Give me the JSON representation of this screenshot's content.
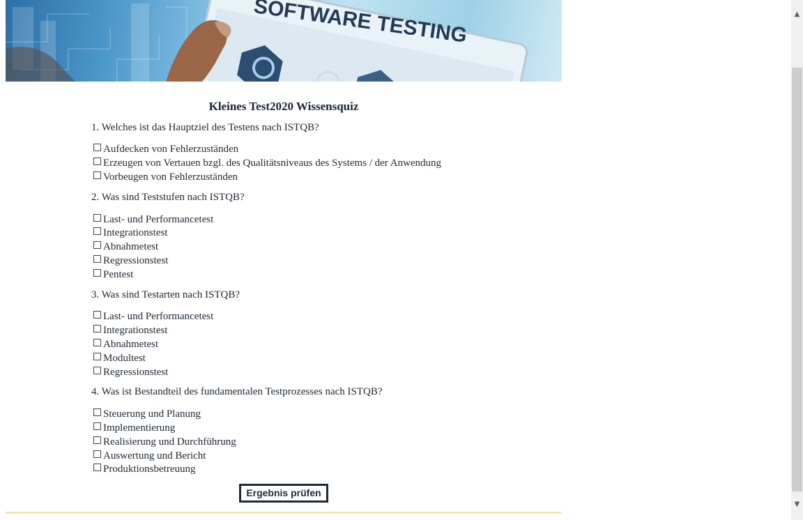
{
  "banner": {
    "text": "SOFTWARE TESTING"
  },
  "quiz": {
    "title": "Kleines Test2020 Wissensquiz",
    "questions": [
      {
        "text": "1. Welches ist das Hauptziel des Testens nach ISTQB?",
        "options": [
          "Aufdecken von Fehlerzuständen",
          "Erzeugen von Vertauen bzgl. des Qualitätsniveaus des Systems / der Anwendung",
          "Vorbeugen von Fehlerzuständen"
        ]
      },
      {
        "text": "2. Was sind Teststufen nach ISTQB?",
        "options": [
          "Last- und Performancetest",
          "Integrationstest",
          "Abnahmetest",
          "Regressionstest",
          "Pentest"
        ]
      },
      {
        "text": "3. Was sind Testarten nach ISTQB?",
        "options": [
          "Last- und Performancetest",
          "Integrationstest",
          "Abnahmetest",
          "Modultest",
          "Regressionstest"
        ]
      },
      {
        "text": "4. Was ist Bestandteil des fundamentalen Testprozesses nach ISTQB?",
        "options": [
          "Steuerung und Planung",
          "Implementierung",
          "Realisierung und Durchführung",
          "Auswertung und Bericht",
          "Produktionsbetreuung"
        ]
      }
    ],
    "submit_label": "Ergebnis prüfen"
  },
  "scrollbar": {
    "up_icon": "chevron-up-icon",
    "down_icon": "chevron-down-icon"
  },
  "colors": {
    "text": "#1d2733",
    "button": "#1c2a36",
    "footer_line": "#f8e4b0"
  }
}
